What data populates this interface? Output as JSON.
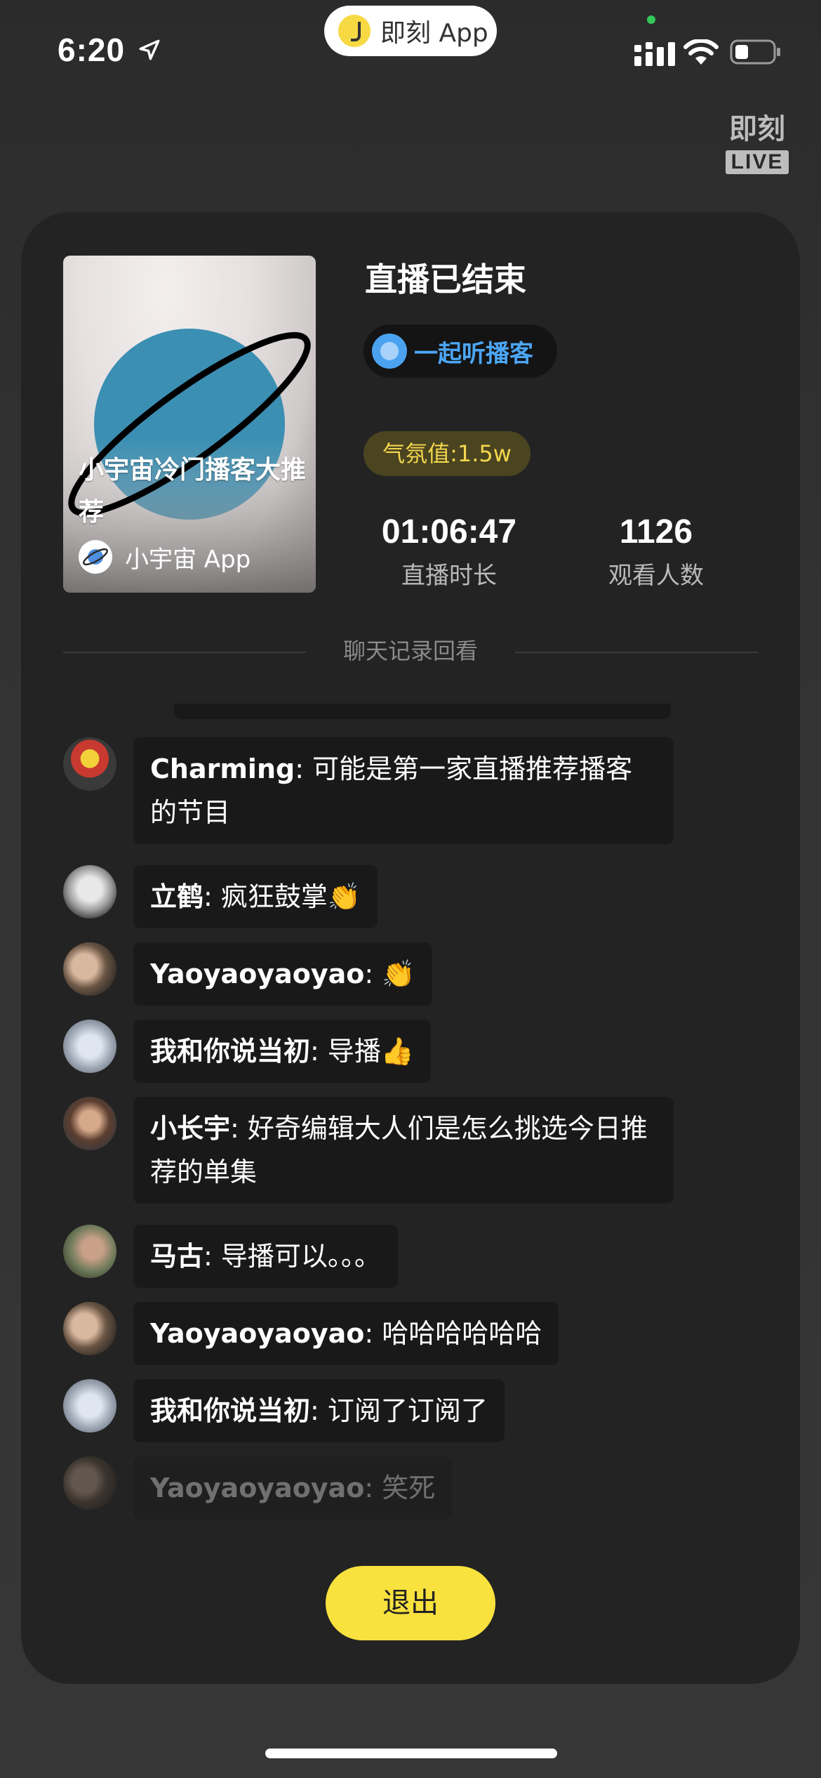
{
  "status_bar": {
    "time": "6:20",
    "app_pill_label": "即刻 App"
  },
  "logo": {
    "top": "即刻",
    "badge": "LIVE"
  },
  "live": {
    "status_title": "直播已结束",
    "topic": "一起听播客",
    "atmosphere": "气氛值:1.5w",
    "duration_value": "01:06:47",
    "duration_label": "直播时长",
    "viewers_value": "1126",
    "viewers_label": "观看人数"
  },
  "cover": {
    "title": "小宇宙冷门播客大推荐",
    "app_name": "小宇宙 App"
  },
  "chat": {
    "section_label": "聊天记录回看",
    "messages": [
      {
        "user": "Charming",
        "text": "可能是第一家直播推荐播客的节目"
      },
      {
        "user": "立鹤",
        "text": "疯狂鼓掌👏"
      },
      {
        "user": "Yaoyaoyaoyao",
        "text": "👏"
      },
      {
        "user": "我和你说当初",
        "text": "导播👍"
      },
      {
        "user": "小长宇",
        "text": "好奇编辑大人们是怎么挑选今日推荐的单集"
      },
      {
        "user": "马古",
        "text": "导播可以。。。"
      },
      {
        "user": "Yaoyaoyaoyao",
        "text": "哈哈哈哈哈哈"
      },
      {
        "user": "我和你说当初",
        "text": "订阅了订阅了"
      },
      {
        "user": "Yaoyaoyaoyao",
        "text": "笑死"
      }
    ]
  },
  "actions": {
    "exit_label": "退出"
  },
  "colors": {
    "accent_yellow": "#f9e23e",
    "topic_blue": "#4ca6f5",
    "card_bg": "#232323",
    "bubble_bg": "#191919"
  }
}
